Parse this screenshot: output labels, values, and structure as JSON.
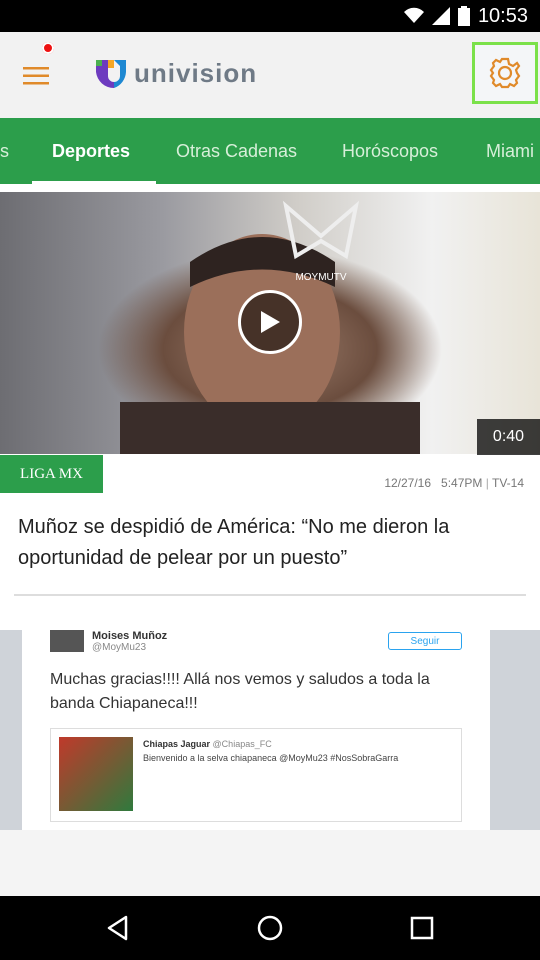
{
  "status_bar": {
    "time": "10:53"
  },
  "header": {
    "brand_text": "univision",
    "brand_colors": [
      "#6d3bbf",
      "#1e88d2",
      "#f5a623",
      "#4caf50"
    ]
  },
  "tabs": [
    {
      "label": "s"
    },
    {
      "label": "Deportes",
      "active": true
    },
    {
      "label": "Otras Cadenas"
    },
    {
      "label": "Horóscopos"
    },
    {
      "label": "Miami"
    }
  ],
  "video": {
    "duration": "0:40",
    "watermark": "MOYMUTV"
  },
  "article": {
    "tag": "LIGA MX",
    "date": "12/27/16",
    "time": "5:47PM",
    "rating": "TV-14",
    "title": "Muñoz se despidió de América: “No me dieron la oportunidad de pelear por un puesto”"
  },
  "tweet": {
    "author": "Moises Muñoz",
    "handle": "@MoyMu23",
    "follow_label": "Seguir",
    "text": "Muchas gracias!!!! Allá nos vemos y saludos a toda la banda Chiapaneca!!!",
    "quoted_author": "Chiapas Jaguar",
    "quoted_handle": "@Chiapas_FC",
    "quoted_text": "Bienvenido a la selva chiapaneca @MoyMu23 #NosSobraGarra"
  },
  "colors": {
    "accent_green": "#2c9e4b",
    "highlight": "#7be14a",
    "notification": "#e11111"
  }
}
